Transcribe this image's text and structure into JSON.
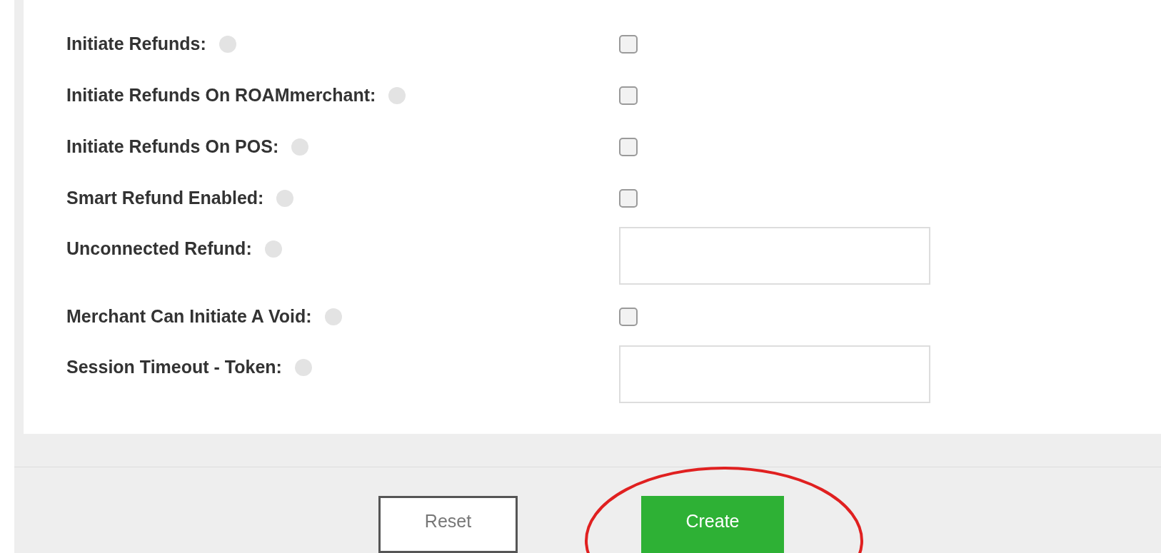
{
  "fields": [
    {
      "label": "Initiate Refunds:",
      "kind": "checkbox",
      "checked": false
    },
    {
      "label": "Initiate Refunds On ROAMmerchant:",
      "kind": "checkbox",
      "checked": false
    },
    {
      "label": "Initiate Refunds On POS:",
      "kind": "checkbox",
      "checked": false
    },
    {
      "label": "Smart Refund Enabled:",
      "kind": "checkbox",
      "checked": false
    },
    {
      "label": "Unconnected Refund:",
      "kind": "text"
    },
    {
      "label": "Merchant Can Initiate A Void:",
      "kind": "checkbox",
      "checked": false
    },
    {
      "label": "Session Timeout - Token:",
      "kind": "text"
    }
  ],
  "buttons": [
    {
      "label": "Reset",
      "kind": "secondary"
    },
    {
      "label": "Create",
      "kind": "primary",
      "highlighted": true
    }
  ]
}
